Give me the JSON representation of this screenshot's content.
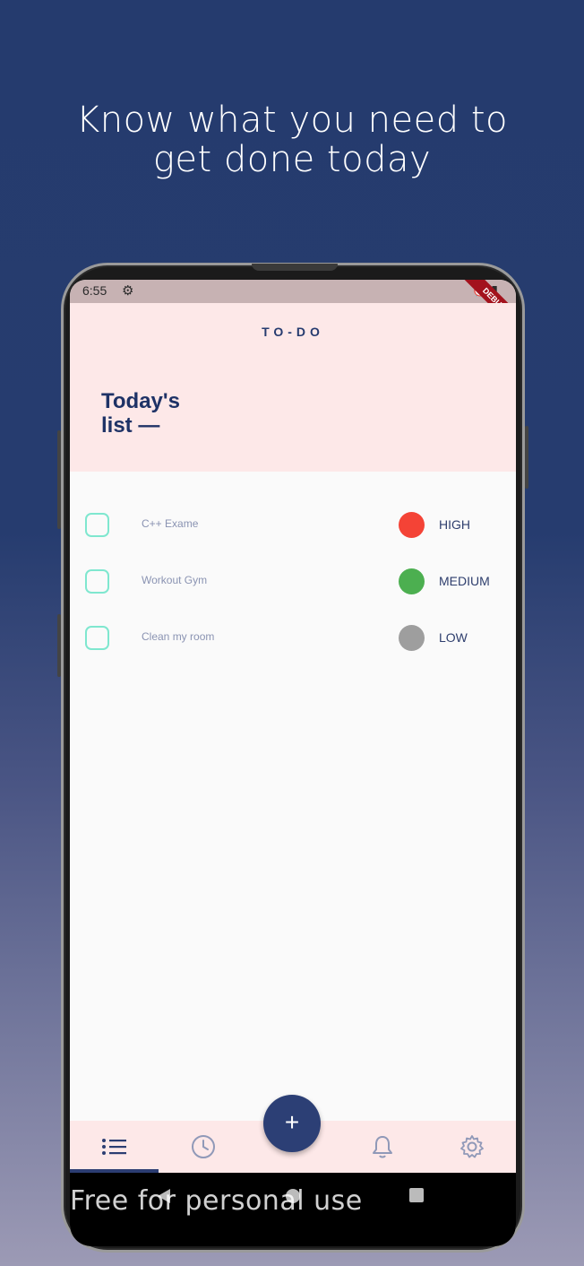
{
  "promo": {
    "headline_line1": "Know what you need to",
    "headline_line2": "get done today"
  },
  "status_bar": {
    "time": "6:55",
    "debug_label": "DEBUG"
  },
  "app": {
    "title": "TO-DO",
    "list_title_line1": "Today's",
    "list_title_line2": "list —"
  },
  "tasks": [
    {
      "text": "C++ Exame",
      "priority": "HIGH",
      "color": "#f44336"
    },
    {
      "text": "Workout Gym",
      "priority": "MEDIUM",
      "color": "#4caf50"
    },
    {
      "text": "Clean my room",
      "priority": "LOW",
      "color": "#9e9e9e"
    }
  ],
  "bottom_nav": {
    "items": [
      "list-icon",
      "clock-icon",
      "bell-icon",
      "gear-icon"
    ],
    "active_index": 0,
    "fab_label": "+"
  },
  "watermark": "Free for personal use",
  "colors": {
    "primary": "#263b6f",
    "header_bg": "#fde8e8",
    "checkbox_border": "#7fe7cf"
  }
}
